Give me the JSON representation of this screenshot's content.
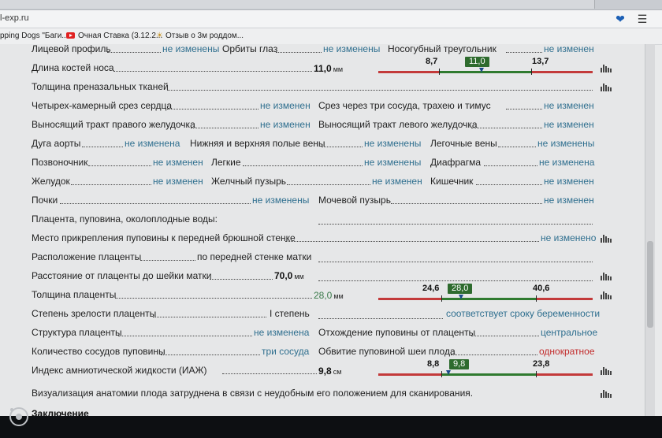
{
  "browser": {
    "url_fragment": "l-exp.ru",
    "bookmarks": [
      {
        "label": "pping Dogs \"Баги..."
      },
      {
        "label": "Очная Ставка (3.12.2..."
      },
      {
        "label": "Отзыв о 3м роддом..."
      }
    ]
  },
  "report": {
    "rows": [
      {
        "label": "Лицевой профиль",
        "value": "не изменены",
        "label2": "Орбиты глаз",
        "value2": "не изменены",
        "label3": "Носогубный треугольник",
        "value3": "не изменен"
      },
      {
        "label": "Длина костей носа",
        "number": "11,0",
        "unit": "мм",
        "scale": {
          "min": "8,7",
          "value": "11,0",
          "max": "13,7"
        }
      },
      {
        "label": "Толщина преназальных тканей"
      },
      {
        "label": "Четырех-камерный срез сердца",
        "value": "не изменен",
        "label2": "Срез через три сосуда, трахею и тимус",
        "value2": "не изменен"
      },
      {
        "label": "Выносящий тракт правого желудочка",
        "value": "не изменен",
        "label2": "Выносящий тракт левого желудочка",
        "value2": "не изменен"
      },
      {
        "label": "Дуга аорты",
        "value": "не изменена",
        "label2": "Нижняя и верхняя полые вены",
        "value2": "не изменены",
        "label3": "Легочные вены",
        "value3": "не изменены"
      },
      {
        "label": "Позвоночник",
        "value": "не изменен",
        "label2": "Легкие",
        "value2": "не изменены",
        "label3": "Диафрагма",
        "value3": "не изменена"
      },
      {
        "label": "Желудок",
        "value": "не изменен",
        "label2": "Желчный пузырь",
        "value2": "не изменен",
        "label3": "Кишечник",
        "value3": "не изменен"
      },
      {
        "label": "Почки",
        "value": "не изменены",
        "label2": "Мочевой пузырь",
        "value2": "не изменен"
      },
      {
        "label": "Плацента, пуповина, околоплодные воды:"
      },
      {
        "label": "Место прикрепления пуповины к передней брюшной стенке",
        "value": "не изменено"
      },
      {
        "label": "Расположение плаценты",
        "value": "по передней стенке матки"
      },
      {
        "label": "Расстояние от плаценты до шейки матки",
        "number": "70,0",
        "unit": "мм"
      },
      {
        "label": "Толщина плаценты",
        "number": "28,0",
        "unit": "мм",
        "scale": {
          "min": "24,6",
          "value": "28,0",
          "max": "40,6"
        }
      },
      {
        "label": "Степень зрелости плаценты",
        "value": "I степень",
        "value2": "соответствует сроку беременности"
      },
      {
        "label": "Структура плаценты",
        "value": "не изменена",
        "label2": "Отхождение пуповины от плаценты",
        "value2": "центральное"
      },
      {
        "label": "Количество сосудов пуповины",
        "value": "три сосуда",
        "label2": "Обвитие пуповиной шеи плода",
        "value2": "однократное"
      },
      {
        "label": "Индекс амниотической жидкости (ИАЖ)",
        "number": "9,8",
        "unit": "см",
        "scale": {
          "min": "8,8",
          "value": "9,8",
          "max": "23,8"
        }
      },
      {
        "label": "Визуализация анатомии плода затруднена в связи с неудобным его положением для сканирования."
      }
    ],
    "footer": "Заключение"
  },
  "colors": {
    "scale_red": "#c33a3a",
    "scale_green": "#2f7a2f",
    "value_text": "#2f6f8f",
    "alert_text": "#c22b2b"
  }
}
